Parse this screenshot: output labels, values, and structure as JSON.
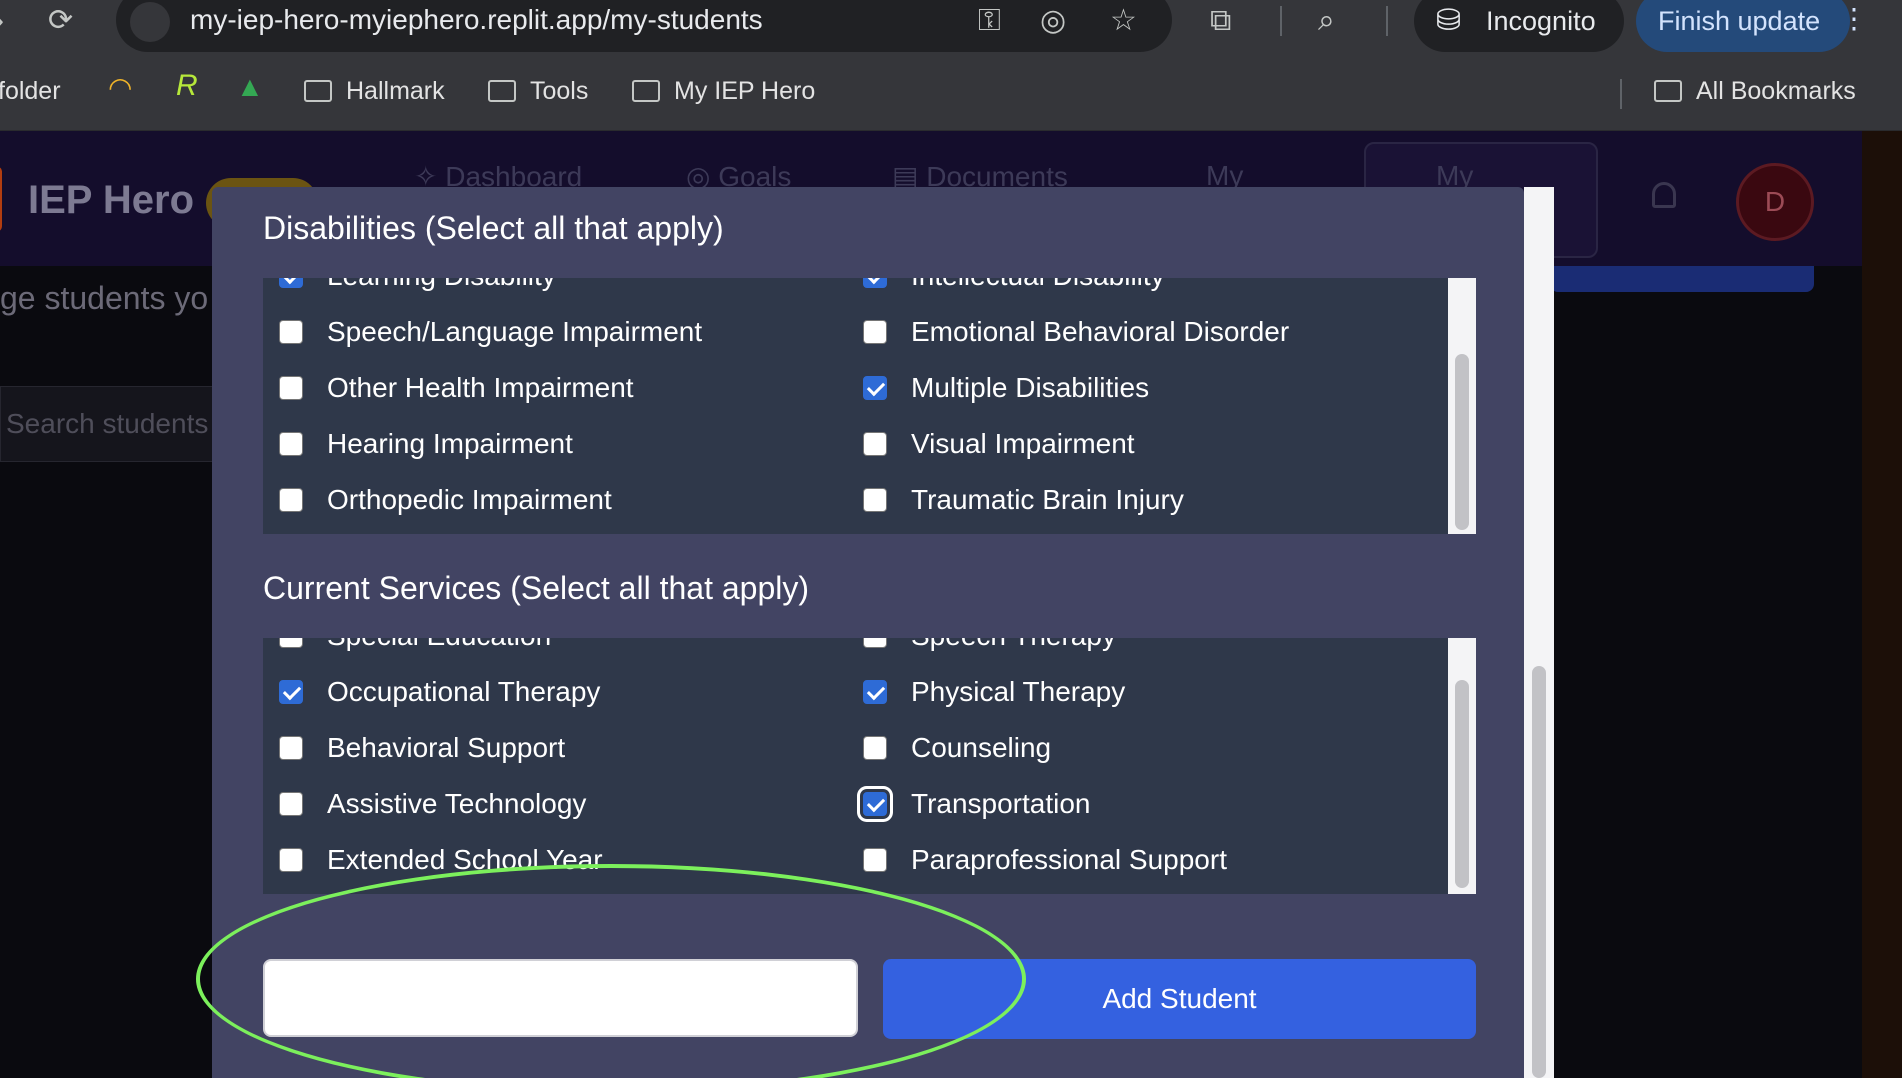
{
  "browser": {
    "url": "my-iep-hero-myiephero.replit.app/my-students",
    "incognito_label": "Incognito",
    "finish_update_label": "Finish update",
    "bookmarks": {
      "folder_partial": "folder",
      "hallmark": "Hallmark",
      "tools": "Tools",
      "my_iep_hero": "My IEP Hero",
      "all_bookmarks": "All Bookmarks"
    }
  },
  "app": {
    "brand": "IEP Hero",
    "nav": {
      "dashboard": "Dashboard",
      "goals": "Goals",
      "documents": "Documents",
      "my": "My",
      "my_active": "My"
    },
    "avatar_initial": "D",
    "page_subtitle_partial": "ge students yo",
    "search_placeholder_partial": "Search students"
  },
  "modal": {
    "disabilities": {
      "title": "Disabilities (Select all that apply)",
      "left": [
        {
          "label": "Learning Disability",
          "checked": true
        },
        {
          "label": "Speech/Language Impairment",
          "checked": false
        },
        {
          "label": "Other Health Impairment",
          "checked": false
        },
        {
          "label": "Hearing Impairment",
          "checked": false
        },
        {
          "label": "Orthopedic Impairment",
          "checked": false
        }
      ],
      "right": [
        {
          "label": "Intellectual Disability",
          "checked": true
        },
        {
          "label": "Emotional Behavioral Disorder",
          "checked": false
        },
        {
          "label": "Multiple Disabilities",
          "checked": true
        },
        {
          "label": "Visual Impairment",
          "checked": false
        },
        {
          "label": "Traumatic Brain Injury",
          "checked": false
        }
      ]
    },
    "services": {
      "title": "Current Services (Select all that apply)",
      "left": [
        {
          "label": "Special Education",
          "checked": false
        },
        {
          "label": "Occupational Therapy",
          "checked": true
        },
        {
          "label": "Behavioral Support",
          "checked": false
        },
        {
          "label": "Assistive Technology",
          "checked": false
        },
        {
          "label": "Extended School Year",
          "checked": false
        }
      ],
      "right": [
        {
          "label": "Speech Therapy",
          "checked": false
        },
        {
          "label": "Physical Therapy",
          "checked": true
        },
        {
          "label": "Counseling",
          "checked": false
        },
        {
          "label": "Transportation",
          "checked": true,
          "focused": true
        },
        {
          "label": "Paraprofessional Support",
          "checked": false
        }
      ]
    },
    "input_value": "",
    "add_button_label": "Add Student"
  },
  "colors": {
    "modal_bg": "#424463",
    "list_bg": "#2f384a",
    "accent": "#3461e0",
    "annotation": "#7cf05c"
  }
}
